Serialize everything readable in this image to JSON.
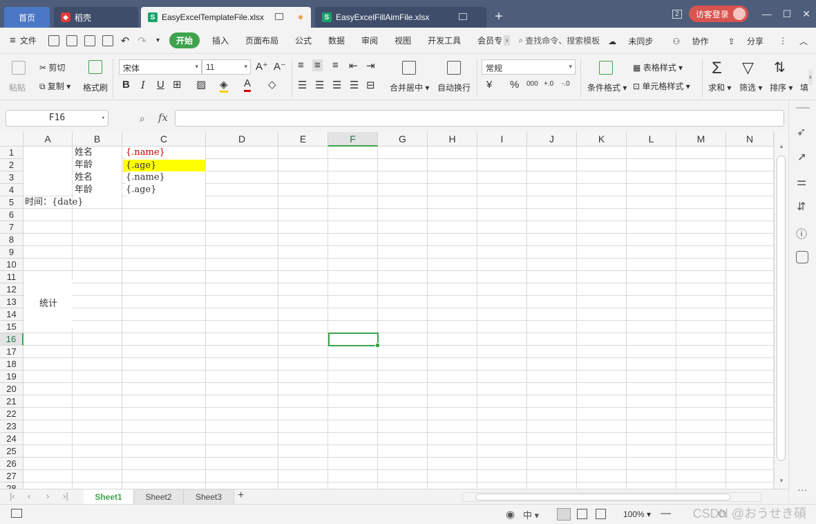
{
  "tabs": {
    "home": "首页",
    "daoke": "稻壳",
    "active_file": "EasyExcelTemplateFile.xlsx",
    "other_file": "EasyExcelFillAimFile.xlsx",
    "add": "+"
  },
  "titlebar": {
    "window_count": "2",
    "visitor_login": "访客登录",
    "minimize": "—",
    "maximize": "☐",
    "close": "✕"
  },
  "menubar": {
    "file": "文件",
    "items": [
      "开始",
      "插入",
      "页面布局",
      "公式",
      "数据",
      "审阅",
      "视图",
      "开发工具",
      "会员专"
    ],
    "search": "查找命令、搜索模板",
    "unsynced": "未同步",
    "collab": "协作",
    "share": "分享"
  },
  "ribbon": {
    "paste": "粘贴",
    "cut": "剪切",
    "copy": "复制",
    "format_painter": "格式刷",
    "font_name": "宋体",
    "font_size": "11",
    "grow_font": "A⁺",
    "shrink_font": "A⁻",
    "bold": "B",
    "italic": "I",
    "underline": "U",
    "merge_center": "合并居中",
    "wrap_text": "自动换行",
    "number_format": "常规",
    "currency": "¥",
    "percent": "%",
    "thousands": "000",
    "inc_decimal": "+.0",
    "dec_decimal": "-.0",
    "conditional_format": "条件格式",
    "table_style": "表格样式",
    "cell_style": "单元格样式",
    "sum": "求和",
    "filter": "筛选",
    "sort": "排序",
    "more": "填"
  },
  "formula_bar": {
    "name_box": "F16",
    "fx": "fx",
    "formula": ""
  },
  "grid": {
    "columns": [
      "A",
      "B",
      "C",
      "D",
      "E",
      "F",
      "G",
      "H",
      "I",
      "J",
      "K",
      "L",
      "M",
      "N"
    ],
    "rows": [
      "1",
      "2",
      "3",
      "4",
      "5",
      "6",
      "7",
      "8",
      "9",
      "10",
      "11",
      "12",
      "13",
      "14",
      "15",
      "16",
      "17",
      "18",
      "19",
      "20",
      "21",
      "22",
      "23",
      "24",
      "25",
      "26",
      "27",
      "28"
    ],
    "selected_cell": "F16",
    "cells": {
      "A1": "统计",
      "B1": "姓名",
      "C1": "{.name}",
      "B2": "年龄",
      "C2": "{.age}",
      "B3": "姓名",
      "C3": "{.name}",
      "B4": "年龄",
      "C4": "{.age}",
      "A5": "时间：{date}"
    },
    "colors": {
      "red_text": "#c00000",
      "yellow_fill": "#ffff00",
      "selection_green": "#3fa34d"
    }
  },
  "sheets": [
    "Sheet1",
    "Sheet2",
    "Sheet3"
  ],
  "active_sheet": "Sheet1",
  "statusbar": {
    "zoom": "100%",
    "watermark": "CSDN @おうせき碩"
  }
}
